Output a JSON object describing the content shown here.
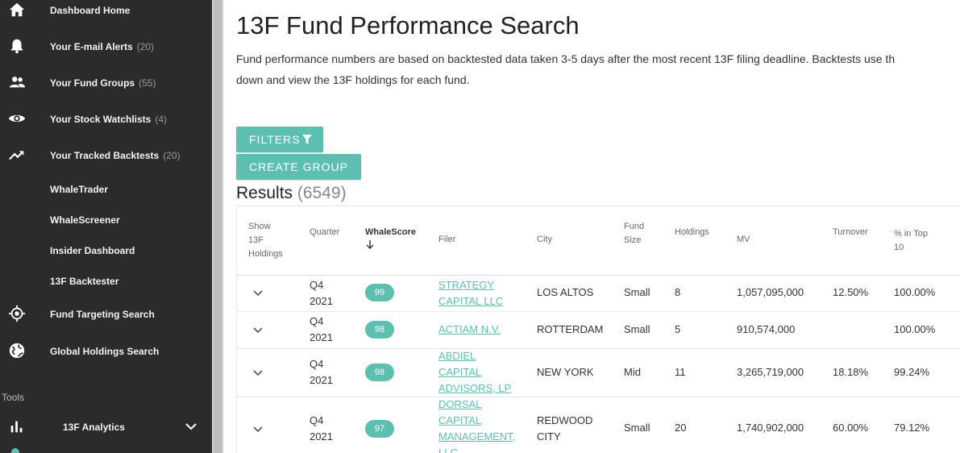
{
  "sidebar": {
    "items": [
      {
        "label": "Dashboard Home",
        "count": "",
        "icon": "home-icon"
      },
      {
        "label": "Your E-mail Alerts",
        "count": "(20)",
        "icon": "bell-icon"
      },
      {
        "label": "Your Fund Groups",
        "count": "(55)",
        "icon": "people-icon"
      },
      {
        "label": "Your Stock Watchlists",
        "count": "(4)",
        "icon": "eye-icon"
      },
      {
        "label": "Your Tracked Backtests",
        "count": "(20)",
        "icon": "trending-up-icon"
      },
      {
        "label": "WhaleTrader",
        "count": ""
      },
      {
        "label": "WhaleScreener",
        "count": ""
      },
      {
        "label": "Insider Dashboard",
        "count": ""
      },
      {
        "label": "13F Backtester",
        "count": ""
      },
      {
        "label": "Fund Targeting Search",
        "count": "",
        "icon": "target-icon"
      },
      {
        "label": "Global Holdings Search",
        "count": "",
        "icon": "globe-icon"
      }
    ],
    "tools_label": "Tools",
    "analytics_label": "13F Analytics"
  },
  "main": {
    "title": "13F Fund Performance Search",
    "description_line1": "Fund performance numbers are based on backtested data taken 3-5 days after the most recent 13F filing deadline. Backtests use th",
    "description_line2": "down and view the 13F holdings for each fund.",
    "filters_label": "FILTERS",
    "create_group_label": "CREATE GROUP",
    "results_label": "Results",
    "results_count": "(6549)"
  },
  "table": {
    "headers": {
      "show": [
        "Show",
        "13F",
        "Holdings"
      ],
      "quarter": "Quarter",
      "whalescore": "WhaleScore",
      "filer": "Filer",
      "city": "City",
      "fund_size": [
        "Fund",
        "Size"
      ],
      "holdings": "Holdings",
      "mv": "MV",
      "turnover": "Turnover",
      "top10": [
        "% in Top",
        "10"
      ]
    },
    "rows": [
      {
        "quarter": [
          "Q4",
          "2021"
        ],
        "score": "99",
        "filer": [
          "STRATEGY",
          "CAPITAL LLC"
        ],
        "city": [
          "LOS ALTOS"
        ],
        "size": "Small",
        "holdings": "8",
        "mv": "1,057,095,000",
        "turnover": "12.50%",
        "top10": "100.00%"
      },
      {
        "quarter": [
          "Q4",
          "2021"
        ],
        "score": "98",
        "filer": [
          "ACTIAM N.V."
        ],
        "city": [
          "ROTTERDAM"
        ],
        "size": "Small",
        "holdings": "5",
        "mv": "910,574,000",
        "turnover": "",
        "top10": "100.00%"
      },
      {
        "quarter": [
          "Q4",
          "2021"
        ],
        "score": "98",
        "filer": [
          "ABDIEL",
          "CAPITAL",
          "ADVISORS, LP"
        ],
        "city": [
          "NEW YORK"
        ],
        "size": "Mid",
        "holdings": "11",
        "mv": "3,265,719,000",
        "turnover": "18.18%",
        "top10": "99.24%"
      },
      {
        "quarter": [
          "Q4",
          "2021"
        ],
        "score": "97",
        "filer": [
          "DORSAL",
          "CAPITAL",
          "MANAGEMENT,",
          "LLC"
        ],
        "city": [
          "REDWOOD",
          "CITY"
        ],
        "size": "Small",
        "holdings": "20",
        "mv": "1,740,902,000",
        "turnover": "60.00%",
        "top10": "79.12%"
      }
    ]
  },
  "colors": {
    "accent": "#5cbfb0",
    "sidebar_bg": "#2b2b2b"
  }
}
